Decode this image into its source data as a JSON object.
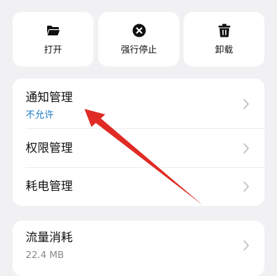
{
  "actions": {
    "open_label": "打开",
    "force_stop_label": "强行停止",
    "uninstall_label": "卸载"
  },
  "settings": {
    "notification": {
      "title": "通知管理",
      "status": "不允许"
    },
    "permission": {
      "title": "权限管理"
    },
    "battery": {
      "title": "耗电管理"
    }
  },
  "traffic": {
    "title": "流量消耗",
    "value": "22.4 MB"
  },
  "icons": {
    "open": "folder-icon",
    "force_stop": "close-circle-icon",
    "uninstall": "trash-icon",
    "row_chevron": "chevron-right-icon"
  },
  "colors": {
    "background": "#f1f1f3",
    "card": "#ffffff",
    "status_blue": "#1a78c2",
    "annotation_arrow": "#e02a25"
  }
}
